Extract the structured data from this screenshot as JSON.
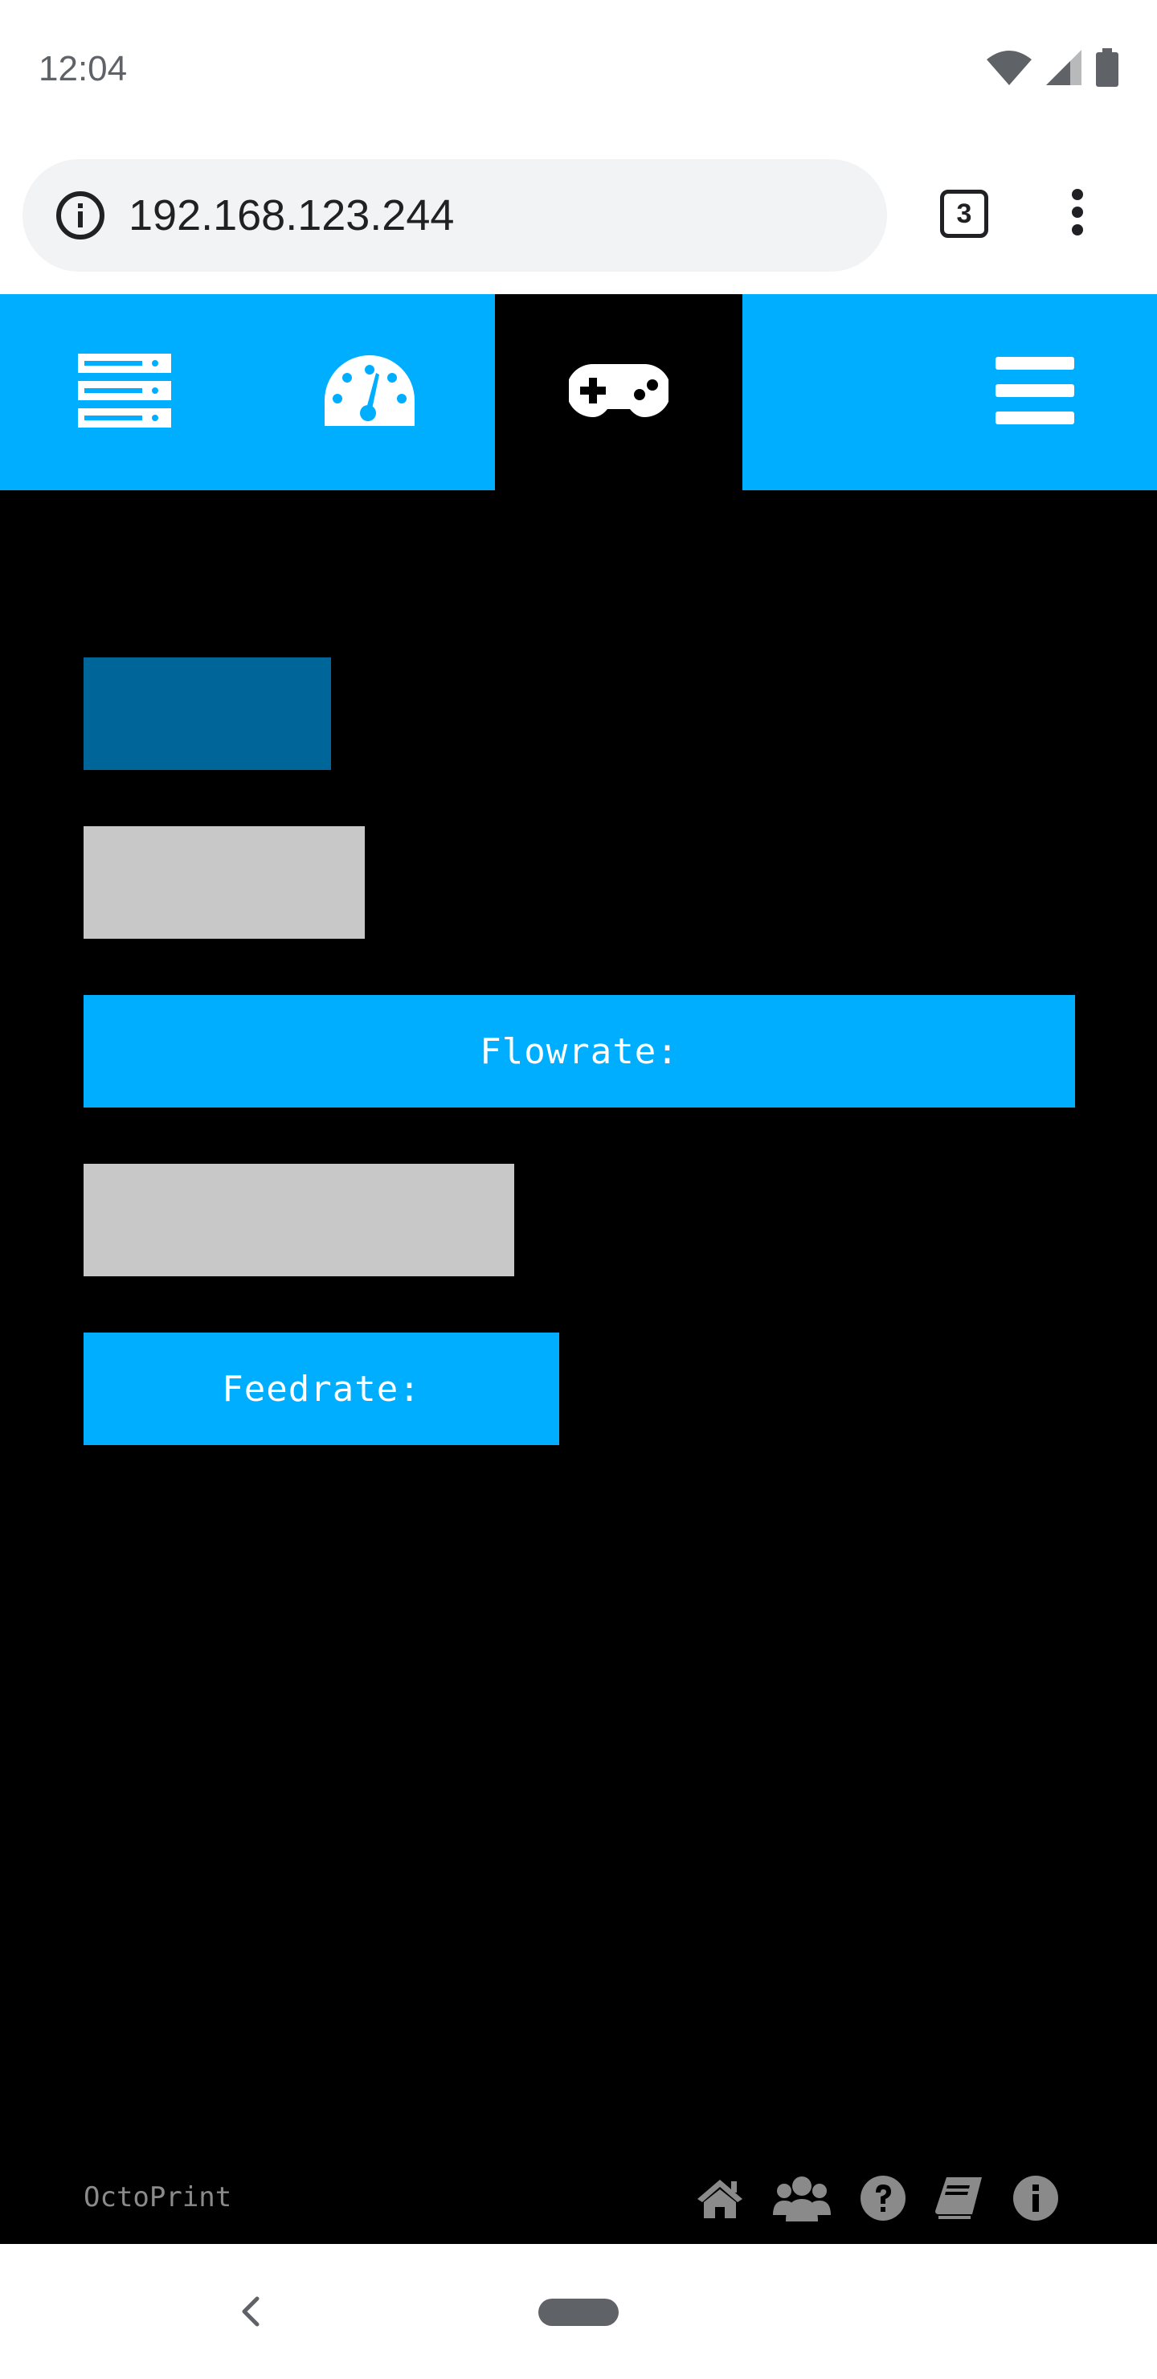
{
  "status_bar": {
    "time": "12:04",
    "icons": [
      "wifi-icon",
      "signal-icon",
      "battery-icon"
    ]
  },
  "browser": {
    "url": "192.168.123.244",
    "tab_count": "3",
    "icons": [
      "info-icon",
      "more-vert-icon"
    ]
  },
  "app_nav": {
    "items": [
      {
        "name": "files",
        "icon": "server-stack-icon",
        "active": false
      },
      {
        "name": "dashboard",
        "icon": "gauge-icon",
        "active": false
      },
      {
        "name": "control",
        "icon": "gamepad-icon",
        "active": true
      },
      {
        "name": "menu",
        "icon": "hamburger-icon",
        "active": false
      }
    ],
    "accent_color": "#00aeff",
    "active_color": "#000000"
  },
  "main": {
    "flowrate_label": "Flowrate:",
    "feedrate_label": "Feedrate:",
    "colors": {
      "primary_block": "#006699",
      "placeholder_block": "#c8c8c8",
      "button": "#00aeff"
    }
  },
  "footer": {
    "brand": "OctoPrint",
    "icons": [
      "home-icon",
      "users-icon",
      "help-icon",
      "book-icon",
      "info-circle-icon"
    ]
  },
  "system_nav": {
    "icons": [
      "back-icon",
      "home-pill"
    ]
  }
}
